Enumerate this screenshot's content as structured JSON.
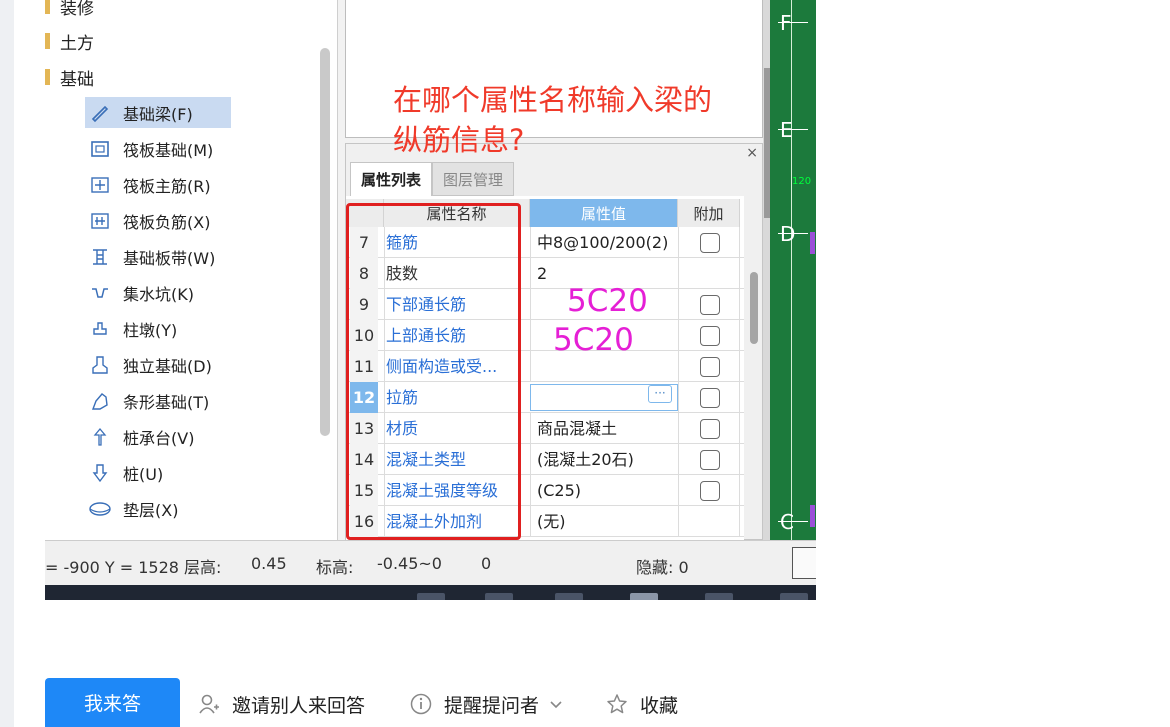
{
  "tree": {
    "categories": [
      {
        "label": "装修"
      },
      {
        "label": "土方"
      },
      {
        "label": "基础"
      }
    ],
    "items": [
      {
        "label": "基础梁(F)",
        "icon": "beam-icon"
      },
      {
        "label": "筏板基础(M)",
        "icon": "raft-icon"
      },
      {
        "label": "筏板主筋(R)",
        "icon": "raft-main-rebar-icon"
      },
      {
        "label": "筏板负筋(X)",
        "icon": "raft-negative-rebar-icon"
      },
      {
        "label": "基础板带(W)",
        "icon": "slab-strip-icon"
      },
      {
        "label": "集水坑(K)",
        "icon": "sump-icon"
      },
      {
        "label": "柱墩(Y)",
        "icon": "column-pier-icon"
      },
      {
        "label": "独立基础(D)",
        "icon": "isolated-footing-icon"
      },
      {
        "label": "条形基础(T)",
        "icon": "strip-footing-icon"
      },
      {
        "label": "桩承台(V)",
        "icon": "pile-cap-icon"
      },
      {
        "label": "桩(U)",
        "icon": "pile-icon"
      },
      {
        "label": "垫层(X)",
        "icon": "cushion-icon"
      }
    ]
  },
  "panel": {
    "close": "×",
    "tabs": [
      "属性列表",
      "图层管理"
    ],
    "headers": {
      "name": "属性名称",
      "value": "属性值",
      "extra": "附加"
    },
    "rows": [
      {
        "num": "7",
        "name": "箍筋",
        "value": "中8@100/200(2)",
        "checkbox": true
      },
      {
        "num": "8",
        "name": "肢数",
        "value": "2",
        "checkbox": false
      },
      {
        "num": "9",
        "name": "下部通长筋",
        "value": "",
        "checkbox": true
      },
      {
        "num": "10",
        "name": "上部通长筋",
        "value": "",
        "checkbox": true
      },
      {
        "num": "11",
        "name": "侧面构造或受...",
        "value": "",
        "checkbox": true
      },
      {
        "num": "12",
        "name": "拉筋",
        "value": "",
        "checkbox": true
      },
      {
        "num": "13",
        "name": "材质",
        "value": "商品混凝土",
        "checkbox": true
      },
      {
        "num": "14",
        "name": "混凝土类型",
        "value": "(混凝土20石)",
        "checkbox": true
      },
      {
        "num": "15",
        "name": "混凝土强度等级",
        "value": "(C25)",
        "checkbox": true
      },
      {
        "num": "16",
        "name": "混凝土外加剂",
        "value": "(无)",
        "checkbox": false
      }
    ],
    "edit_button": "···"
  },
  "annotations": {
    "question": "在哪个属性名称输入梁的纵筋信息?",
    "answer1": "5C20",
    "answer2": "5C20"
  },
  "cad": {
    "axes": [
      "F",
      "E",
      "D",
      "C"
    ],
    "dim": "120"
  },
  "status": {
    "coords": "= -900 Y = 1528 层高:",
    "floor_height": "0.45",
    "elev_label": "标高:",
    "elev_value": "-0.45~0",
    "zero": "0",
    "hidden": "隐藏: 0"
  },
  "actions": {
    "answer": "我来答",
    "invite": "邀请别人来回答",
    "remind": "提醒提问者",
    "favorite": "收藏"
  },
  "colors": {
    "accent": "#1e88f7",
    "annotation_red": "#f03a2a",
    "annotation_magenta": "#e51fd5",
    "cad_green": "#1c7a3c"
  }
}
